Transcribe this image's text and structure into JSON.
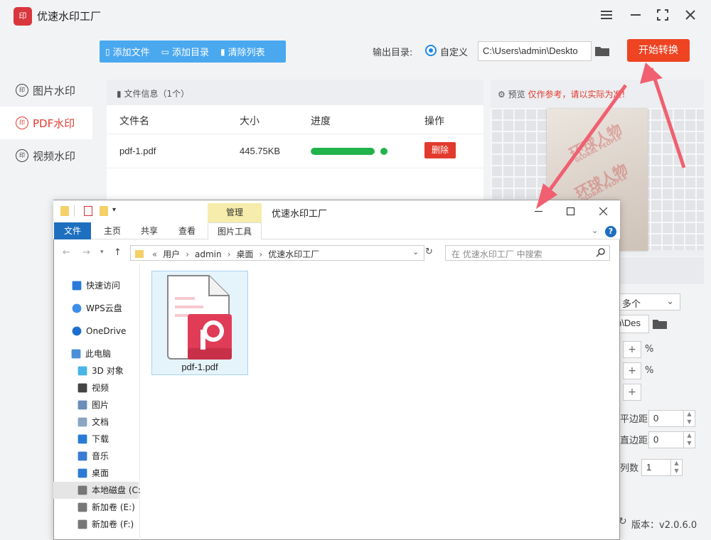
{
  "app": {
    "title": "优速水印工厂",
    "logo_text": "印"
  },
  "sidebar": {
    "items": [
      {
        "label": "图片水印",
        "icon": "watermark-icon",
        "active": false
      },
      {
        "label": "PDF水印",
        "icon": "watermark-icon",
        "active": true
      },
      {
        "label": "视频水印",
        "icon": "watermark-icon",
        "active": false
      }
    ]
  },
  "toolbar": {
    "add_file": "添加文件",
    "add_folder": "添加目录",
    "clear_list": "清除列表"
  },
  "output": {
    "label": "输出目录:",
    "radio_label": "自定义",
    "path": "C:\\Users\\admin\\Deskto",
    "start_button": "开始转换"
  },
  "file_list": {
    "header": "文件信息（1个）",
    "columns": [
      "文件名",
      "大小",
      "进度",
      "操作"
    ],
    "rows": [
      {
        "name": "pdf-1.pdf",
        "size": "445.75KB",
        "progress": 1.0,
        "action": "删除"
      }
    ]
  },
  "preview": {
    "label": "预览",
    "warning": "仅作参考，请以实际为准!",
    "watermark_lines": [
      "环球人物",
      "GLOBAL PEOPLE"
    ]
  },
  "settings": {
    "count_select": "多个",
    "path_fragment": "n\\Des",
    "percent_1": "%",
    "percent_2": "%",
    "h_margin_label": "平边距",
    "h_margin_value": "0",
    "v_margin_label": "直边距",
    "v_margin_value": "0",
    "columns_label": "列数",
    "columns_value": "1",
    "version": "版本：v2.0.6.0"
  },
  "explorer": {
    "title": "优速水印工厂",
    "manage_tab": "管理",
    "ribbon_tabs": [
      "文件",
      "主页",
      "共享",
      "查看"
    ],
    "picture_tools_tab": "图片工具",
    "breadcrumb": [
      "用户",
      "admin",
      "桌面",
      "优速水印工厂"
    ],
    "breadcrumb_prefix": "«",
    "search_placeholder": "在 优速水印工厂 中搜索",
    "nav": [
      {
        "label": "快速访问",
        "icon": "star-icon"
      },
      {
        "label": "WPS云盘",
        "icon": "cloud-icon"
      },
      {
        "label": "OneDrive",
        "icon": "onedrive-icon"
      },
      {
        "label": "此电脑",
        "icon": "computer-icon"
      },
      {
        "label": "3D 对象",
        "icon": "cube-icon"
      },
      {
        "label": "视频",
        "icon": "video-icon"
      },
      {
        "label": "图片",
        "icon": "picture-icon"
      },
      {
        "label": "文档",
        "icon": "document-icon"
      },
      {
        "label": "下载",
        "icon": "download-icon"
      },
      {
        "label": "音乐",
        "icon": "music-icon"
      },
      {
        "label": "桌面",
        "icon": "desktop-icon"
      },
      {
        "label": "本地磁盘 (C:",
        "icon": "drive-icon"
      },
      {
        "label": "新加卷 (E:)",
        "icon": "drive-icon"
      },
      {
        "label": "新加卷 (F:)",
        "icon": "drive-icon"
      }
    ],
    "file": {
      "name": "pdf-1.pdf",
      "icon": "pdf-file-icon"
    }
  },
  "colors": {
    "accent_red": "#e23b2e",
    "toolbar_blue": "#4aa8ef",
    "progress_green": "#22b24c",
    "start_button": "#ee4422"
  }
}
